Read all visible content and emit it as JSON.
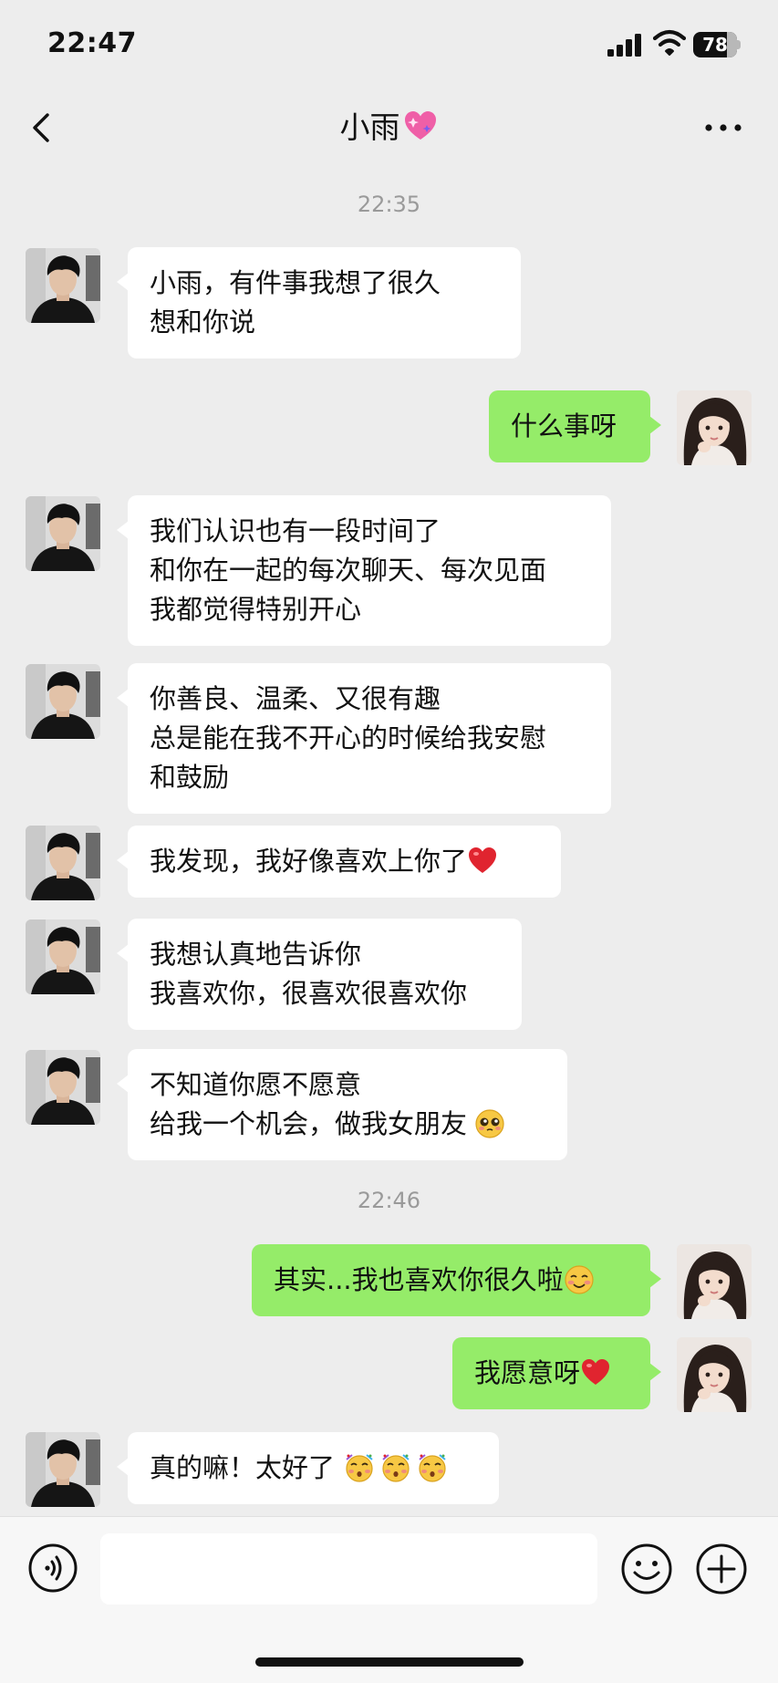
{
  "status_bar": {
    "time": "22:47",
    "battery": "78",
    "battery_level": 0.78
  },
  "nav": {
    "title": "小雨",
    "title_icon": "sparkling-heart-icon",
    "back_icon": "chevron-left-icon",
    "more_icon": "more-dots-icon"
  },
  "chat": {
    "timestamps": [
      "22:35",
      "22:46"
    ],
    "messages": [
      {
        "side": "in",
        "lines": [
          "小雨，有件事我想了很久",
          "想和你说"
        ]
      },
      {
        "side": "out",
        "lines": [
          "什么事呀"
        ]
      },
      {
        "side": "in",
        "lines": [
          "我们认识也有一段时间了",
          "和你在一起的每次聊天、每次见面",
          "我都觉得特别开心"
        ]
      },
      {
        "side": "in",
        "lines": [
          "你善良、温柔、又很有趣",
          "总是能在我不开心的时候给我安慰",
          "和鼓励"
        ]
      },
      {
        "side": "in",
        "lines": [
          "我发现，我好像喜欢上你了"
        ],
        "emoji": "red-heart-icon"
      },
      {
        "side": "in",
        "lines": [
          "我想认真地告诉你",
          "我喜欢你，很喜欢很喜欢你"
        ]
      },
      {
        "side": "in",
        "lines": [
          "不知道你愿不愿意",
          "给我一个机会，做我女朋友"
        ],
        "emoji": "pleading-face-icon"
      },
      {
        "side": "out",
        "lines": [
          "其实...我也喜欢你很久啦"
        ],
        "emoji": "smiling-blush-icon"
      },
      {
        "side": "out",
        "lines": [
          "我愿意呀"
        ],
        "emoji": "red-heart-icon"
      },
      {
        "side": "in",
        "lines": [
          "真的嘛！太好了"
        ],
        "emoji": "party-face-icon x3"
      }
    ]
  },
  "input_bar": {
    "voice_icon": "voice-icon",
    "input_placeholder": "",
    "emoji_icon": "emoji-face-icon",
    "plus_icon": "plus-circle-icon"
  },
  "colors": {
    "background": "#ededed",
    "incoming_bubble": "#ffffff",
    "outgoing_bubble": "#95ec69",
    "timestamp": "#9a9a9a"
  }
}
